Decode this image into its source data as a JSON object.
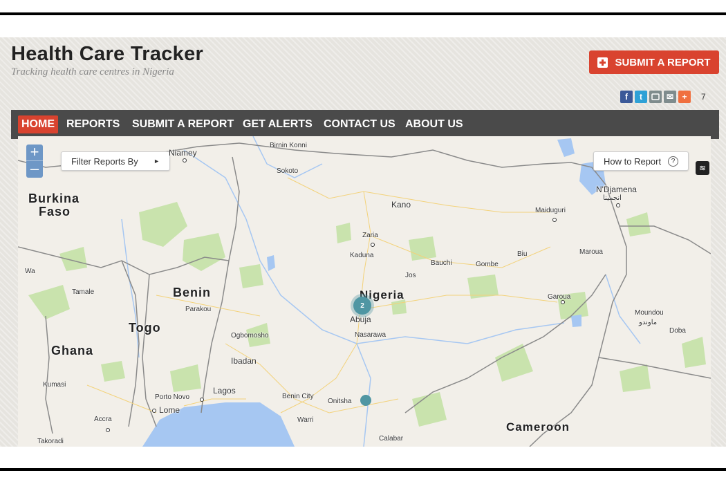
{
  "site": {
    "title": "Health Care Tracker",
    "tagline": "Tracking health care centres in Nigeria",
    "submit_label": "SUBMIT A REPORT",
    "share_count": "7"
  },
  "nav": {
    "items": [
      "HOME",
      "REPORTS",
      "SUBMIT A REPORT",
      "GET ALERTS",
      "CONTACT US",
      "ABOUT US"
    ],
    "active": "HOME"
  },
  "map_controls": {
    "zoom_in": "+",
    "zoom_out": "–",
    "filter_label": "Filter Reports By",
    "howto_label": "How to Report",
    "howto_icon_glyph": "?"
  },
  "map_labels": {
    "niamey": "Niamey",
    "birnin_konni": "Birnin Konni",
    "sokoto": "Sokoto",
    "burkina_faso_1": "Burkina",
    "burkina_faso_2": "Faso",
    "ndjamena": "N'Djamena",
    "ndjamena_ar": "انجمينا",
    "kano": "Kano",
    "maiduguri": "Maiduguri",
    "zaria": "Zaria",
    "kaduna": "Kaduna",
    "bauchi": "Bauchi",
    "gombe": "Gombe",
    "biu": "Biu",
    "maroua": "Maroua",
    "jos": "Jos",
    "wa": "Wa",
    "tamale": "Tamale",
    "benin": "Benin",
    "parakou": "Parakou",
    "nigeria": "Nigeria",
    "abuja": "Abuja",
    "nasarawa": "Nasarawa",
    "garoua": "Garoua",
    "togo": "Togo",
    "moundou": "Moundou",
    "moundou_ar": "ماوندو",
    "doba": "Doba",
    "ghana": "Ghana",
    "ogbomosho": "Ogbomosho",
    "ibadan": "Ibadan",
    "kumasi": "Kumasi",
    "porto_novo": "Porto Novo",
    "lagos": "Lagos",
    "lome": "Lome",
    "benin_city": "Benin City",
    "onitsha": "Onitsha",
    "accra": "Accra",
    "warri": "Warri",
    "cameroon": "Cameroon",
    "takoradi": "Takoradi",
    "calabar": "Calabar"
  },
  "clusters": [
    {
      "count": "2",
      "location": "Abuja"
    }
  ],
  "icons": {
    "facebook": "f",
    "twitter": "t",
    "email": "✉",
    "plus": "+",
    "layers": "≋"
  },
  "colors": {
    "accent": "#d9432f",
    "nav_bg": "#4a4a4a",
    "marker": "#4f96a3",
    "water": "#a6c7f2",
    "vegetation": "#c6e2a8"
  }
}
